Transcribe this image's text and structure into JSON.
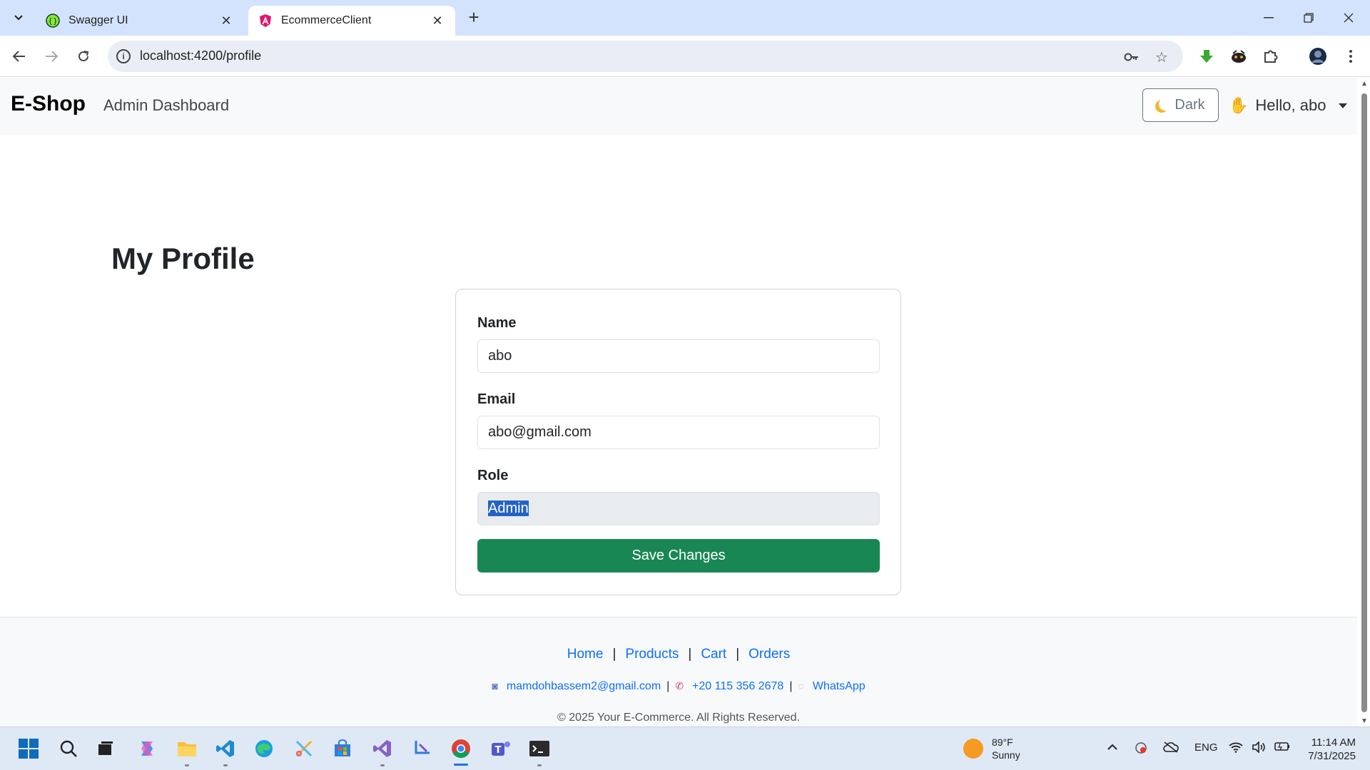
{
  "browser": {
    "tabs": [
      {
        "title": "Swagger UI",
        "favicon": "swagger-icon",
        "active": false
      },
      {
        "title": "EcommerceClient",
        "favicon": "angular-icon",
        "active": true
      }
    ],
    "url": "localhost:4200/profile"
  },
  "site": {
    "brand": "E-Shop",
    "nav_link": "Admin Dashboard",
    "theme_button": "Dark",
    "user_greeting": "Hello, abo",
    "page_title": "My Profile"
  },
  "profile_form": {
    "name_label": "Name",
    "name_value": "abo",
    "email_label": "Email",
    "email_value": "abo@gmail.com",
    "role_label": "Role",
    "role_value": "Admin",
    "save_label": "Save Changes"
  },
  "footer": {
    "links": [
      "Home",
      "Products",
      "Cart",
      "Orders"
    ],
    "email": "mamdohbassem2@gmail.com",
    "phone": "+20 115 356 2678",
    "whatsapp": "WhatsApp",
    "copyright": "© 2025 Your E-Commerce. All Rights Reserved."
  },
  "taskbar": {
    "weather_temp": "89°F",
    "weather_desc": "Sunny",
    "language": "ENG",
    "time": "11:14 AM",
    "date": "7/31/2025"
  },
  "colors": {
    "primary_green": "#198754",
    "link_blue": "#0d6efd",
    "tabbar": "#d3e3fd",
    "selection": "#2463c5"
  }
}
